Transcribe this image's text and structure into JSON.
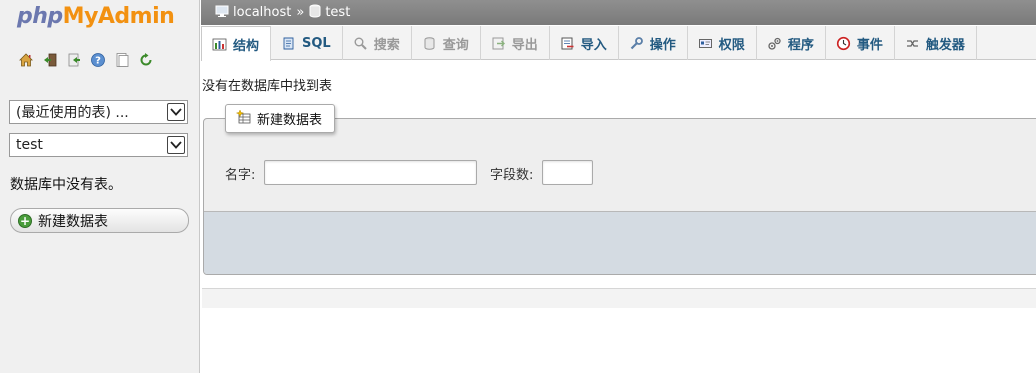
{
  "logo": {
    "php": "php",
    "my": "My",
    "admin": "Admin"
  },
  "sidebar": {
    "quick_icons": [
      "home-icon",
      "exit-icon",
      "sql-query-icon",
      "help-icon",
      "docs-icon",
      "reload-icon"
    ],
    "recent_tables_select": "(最近使用的表) ...",
    "database_select": "test",
    "no_tables_text": "数据库中没有表。",
    "new_table_button": "新建数据表"
  },
  "breadcrumb": {
    "server": "localhost",
    "separator": "»",
    "database": "test"
  },
  "tabs": [
    {
      "label": "结构",
      "icon": "structure-icon",
      "active": true,
      "disabled": false
    },
    {
      "label": "SQL",
      "icon": "sql-icon",
      "active": false,
      "disabled": false
    },
    {
      "label": "搜索",
      "icon": "search-icon",
      "active": false,
      "disabled": true
    },
    {
      "label": "查询",
      "icon": "query-icon",
      "active": false,
      "disabled": true
    },
    {
      "label": "导出",
      "icon": "export-icon",
      "active": false,
      "disabled": true
    },
    {
      "label": "导入",
      "icon": "import-icon",
      "active": false,
      "disabled": false
    },
    {
      "label": "操作",
      "icon": "wrench-icon",
      "active": false,
      "disabled": false
    },
    {
      "label": "权限",
      "icon": "privileges-icon",
      "active": false,
      "disabled": false
    },
    {
      "label": "程序",
      "icon": "routines-icon",
      "active": false,
      "disabled": false
    },
    {
      "label": "事件",
      "icon": "events-icon",
      "active": false,
      "disabled": false
    },
    {
      "label": "触发器",
      "icon": "triggers-icon",
      "active": false,
      "disabled": false
    }
  ],
  "main": {
    "message": "没有在数据库中找到表",
    "create_table": {
      "legend": "新建数据表",
      "name_label": "名字:",
      "name_value": "",
      "columns_label": "字段数:",
      "columns_value": ""
    }
  },
  "colors": {
    "accent": "#235a81",
    "topbar": "#858585",
    "logo_php": "#6c78af",
    "logo_orange": "#f29111"
  }
}
